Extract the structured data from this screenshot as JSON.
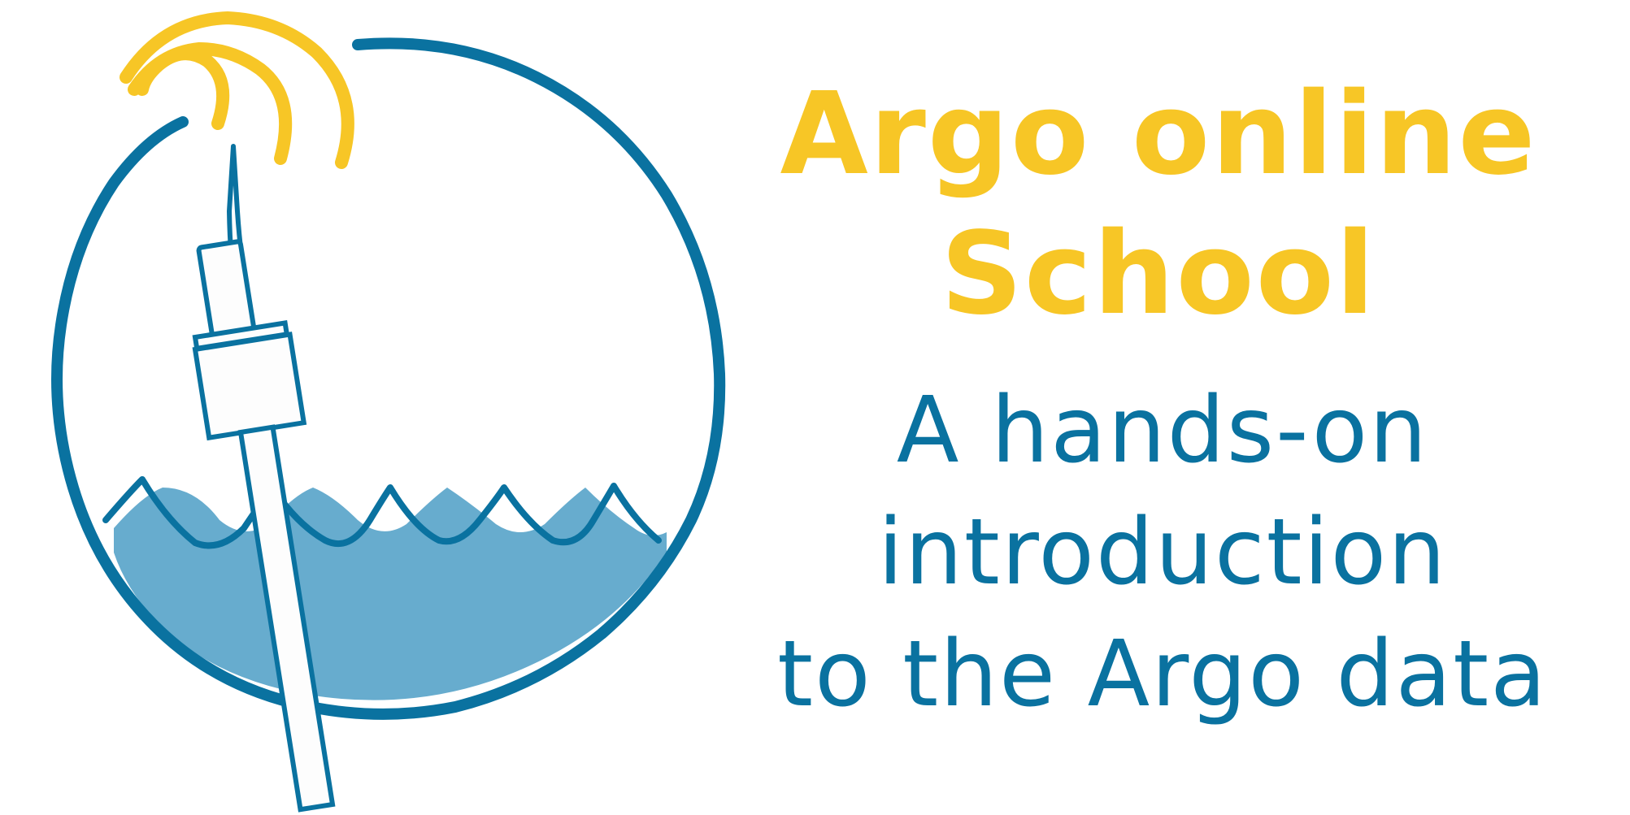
{
  "title": {
    "line1": "Argo online",
    "line2": "School"
  },
  "subtitle": {
    "line1": "A hands-on",
    "line2": "introduction",
    "line3": "to the Argo data"
  },
  "colors": {
    "title": "#f7c626",
    "subtitle": "#0a72a0",
    "circle_outline": "#0a72a0",
    "water": "#67acce",
    "signal_waves": "#f7c626",
    "float_body": "#fdfdfd"
  },
  "icons": {
    "logo": "argo-float-logo",
    "signal": "signal-waves-icon"
  }
}
